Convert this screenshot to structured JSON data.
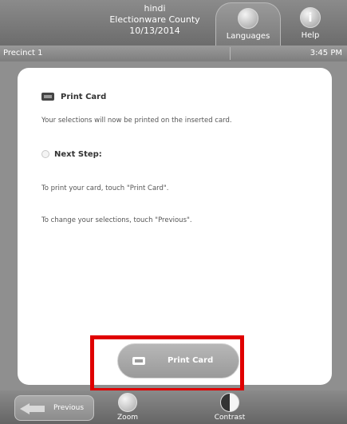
{
  "header": {
    "language": "hindi",
    "county": "Electionware County",
    "date": "10/13/2014",
    "languages_label": "Languages",
    "help_label": "Help",
    "help_icon_glyph": "i"
  },
  "precinct": {
    "label": "Precinct 1",
    "time": "3:45 PM"
  },
  "content": {
    "print_title": "Print Card",
    "print_desc": "Your selections will now be printed on the inserted card.",
    "next_title": "Next Step:",
    "instruction_1": "To print your card, touch \"Print Card\".",
    "instruction_2": "To change your selections, touch \"Previous\"."
  },
  "actions": {
    "print_card_label": "Print Card",
    "previous_label": "Previous",
    "zoom_label": "Zoom",
    "contrast_label": "Contrast"
  },
  "colors": {
    "highlight": "#e00000"
  }
}
